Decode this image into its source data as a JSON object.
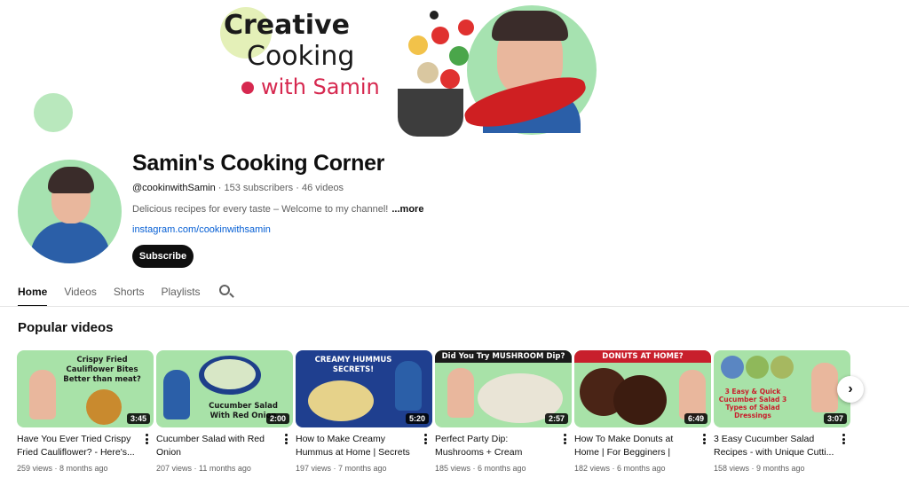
{
  "banner": {
    "line1": "Creative",
    "line2": "Cooking",
    "line3": "with Samin"
  },
  "channel": {
    "name": "Samin's Cooking Corner",
    "handle": "@cookinwithSamin",
    "subscribers": "153 subscribers",
    "videos": "46 videos",
    "description": "Delicious recipes for every taste – Welcome to my channel!",
    "more_label": "...more",
    "link": "instagram.com/cookinwithsamin",
    "subscribe_label": "Subscribe"
  },
  "tabs": [
    {
      "label": "Home",
      "active": true
    },
    {
      "label": "Videos",
      "active": false
    },
    {
      "label": "Shorts",
      "active": false
    },
    {
      "label": "Playlists",
      "active": false
    }
  ],
  "section": {
    "title": "Popular videos"
  },
  "videos": [
    {
      "title": "Have You Ever Tried Crispy Fried Cauliflower? - Here's...",
      "views": "259 views",
      "age": "8 months ago",
      "duration": "3:45",
      "thumb_text": "Crispy Fried Cauliflower Bites Better than meat?",
      "thumb_color": "#a8e2a8"
    },
    {
      "title": "Cucumber Salad with Red Onion",
      "views": "207 views",
      "age": "11 months ago",
      "duration": "2:00",
      "thumb_text": "Cucumber Salad With Red Onion",
      "thumb_color": "#a8e2a8"
    },
    {
      "title": "How to Make Creamy Hummus at Home | Secrets ...",
      "views": "197 views",
      "age": "7 months ago",
      "duration": "5:20",
      "thumb_text": "CREAMY HUMMUS SECRETS!",
      "thumb_color": "#1f3f8f"
    },
    {
      "title": "Perfect Party Dip: Mushrooms + Cream Chees...",
      "views": "185 views",
      "age": "6 months ago",
      "duration": "2:57",
      "thumb_text": "Did You Try MUSHROOM Dip?",
      "thumb_color": "#a8e2a8"
    },
    {
      "title": "How To Make Donuts at Home | For Begginers | Easy...",
      "views": "182 views",
      "age": "6 months ago",
      "duration": "6:49",
      "thumb_text": "DONUTS AT HOME?",
      "thumb_color": "#a8e2a8"
    },
    {
      "title": "3 Easy Cucumber Salad Recipes - with Unique Cutti...",
      "views": "158 views",
      "age": "9 months ago",
      "duration": "3:07",
      "thumb_text": "3 Easy & Quick Cucumber Salad 3 Types of Salad Dressings",
      "thumb_color": "#a8e2a8"
    }
  ],
  "icons": {
    "search": "search-icon",
    "next": "chevron-right-icon",
    "more": "more-vert-icon"
  }
}
